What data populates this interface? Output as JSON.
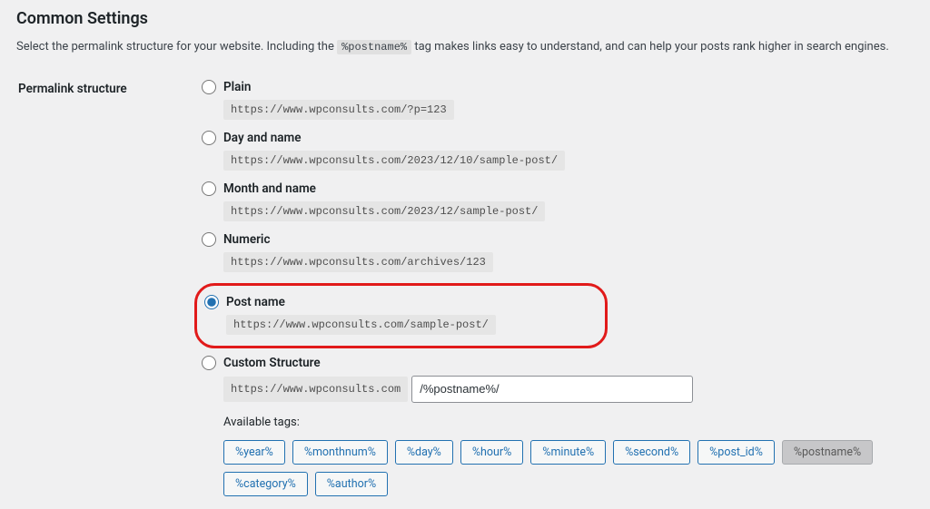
{
  "section": {
    "title": "Common Settings",
    "desc_before": "Select the permalink structure for your website. Including the ",
    "desc_tag": "%postname%",
    "desc_after": " tag makes links easy to understand, and can help your posts rank higher in search engines."
  },
  "form": {
    "row_label": "Permalink structure"
  },
  "options": {
    "plain": {
      "label": "Plain",
      "example": "https://www.wpconsults.com/?p=123"
    },
    "day_name": {
      "label": "Day and name",
      "example": "https://www.wpconsults.com/2023/12/10/sample-post/"
    },
    "month_name": {
      "label": "Month and name",
      "example": "https://www.wpconsults.com/2023/12/sample-post/"
    },
    "numeric": {
      "label": "Numeric",
      "example": "https://www.wpconsults.com/archives/123"
    },
    "post_name": {
      "label": "Post name",
      "example": "https://www.wpconsults.com/sample-post/"
    },
    "custom": {
      "label": "Custom Structure",
      "url_prefix": "https://www.wpconsults.com",
      "input_value": "/%postname%/"
    }
  },
  "tags": {
    "label": "Available tags:",
    "items": [
      "%year%",
      "%monthnum%",
      "%day%",
      "%hour%",
      "%minute%",
      "%second%",
      "%post_id%",
      "%postname%",
      "%category%",
      "%author%"
    ],
    "active_index": 7
  }
}
